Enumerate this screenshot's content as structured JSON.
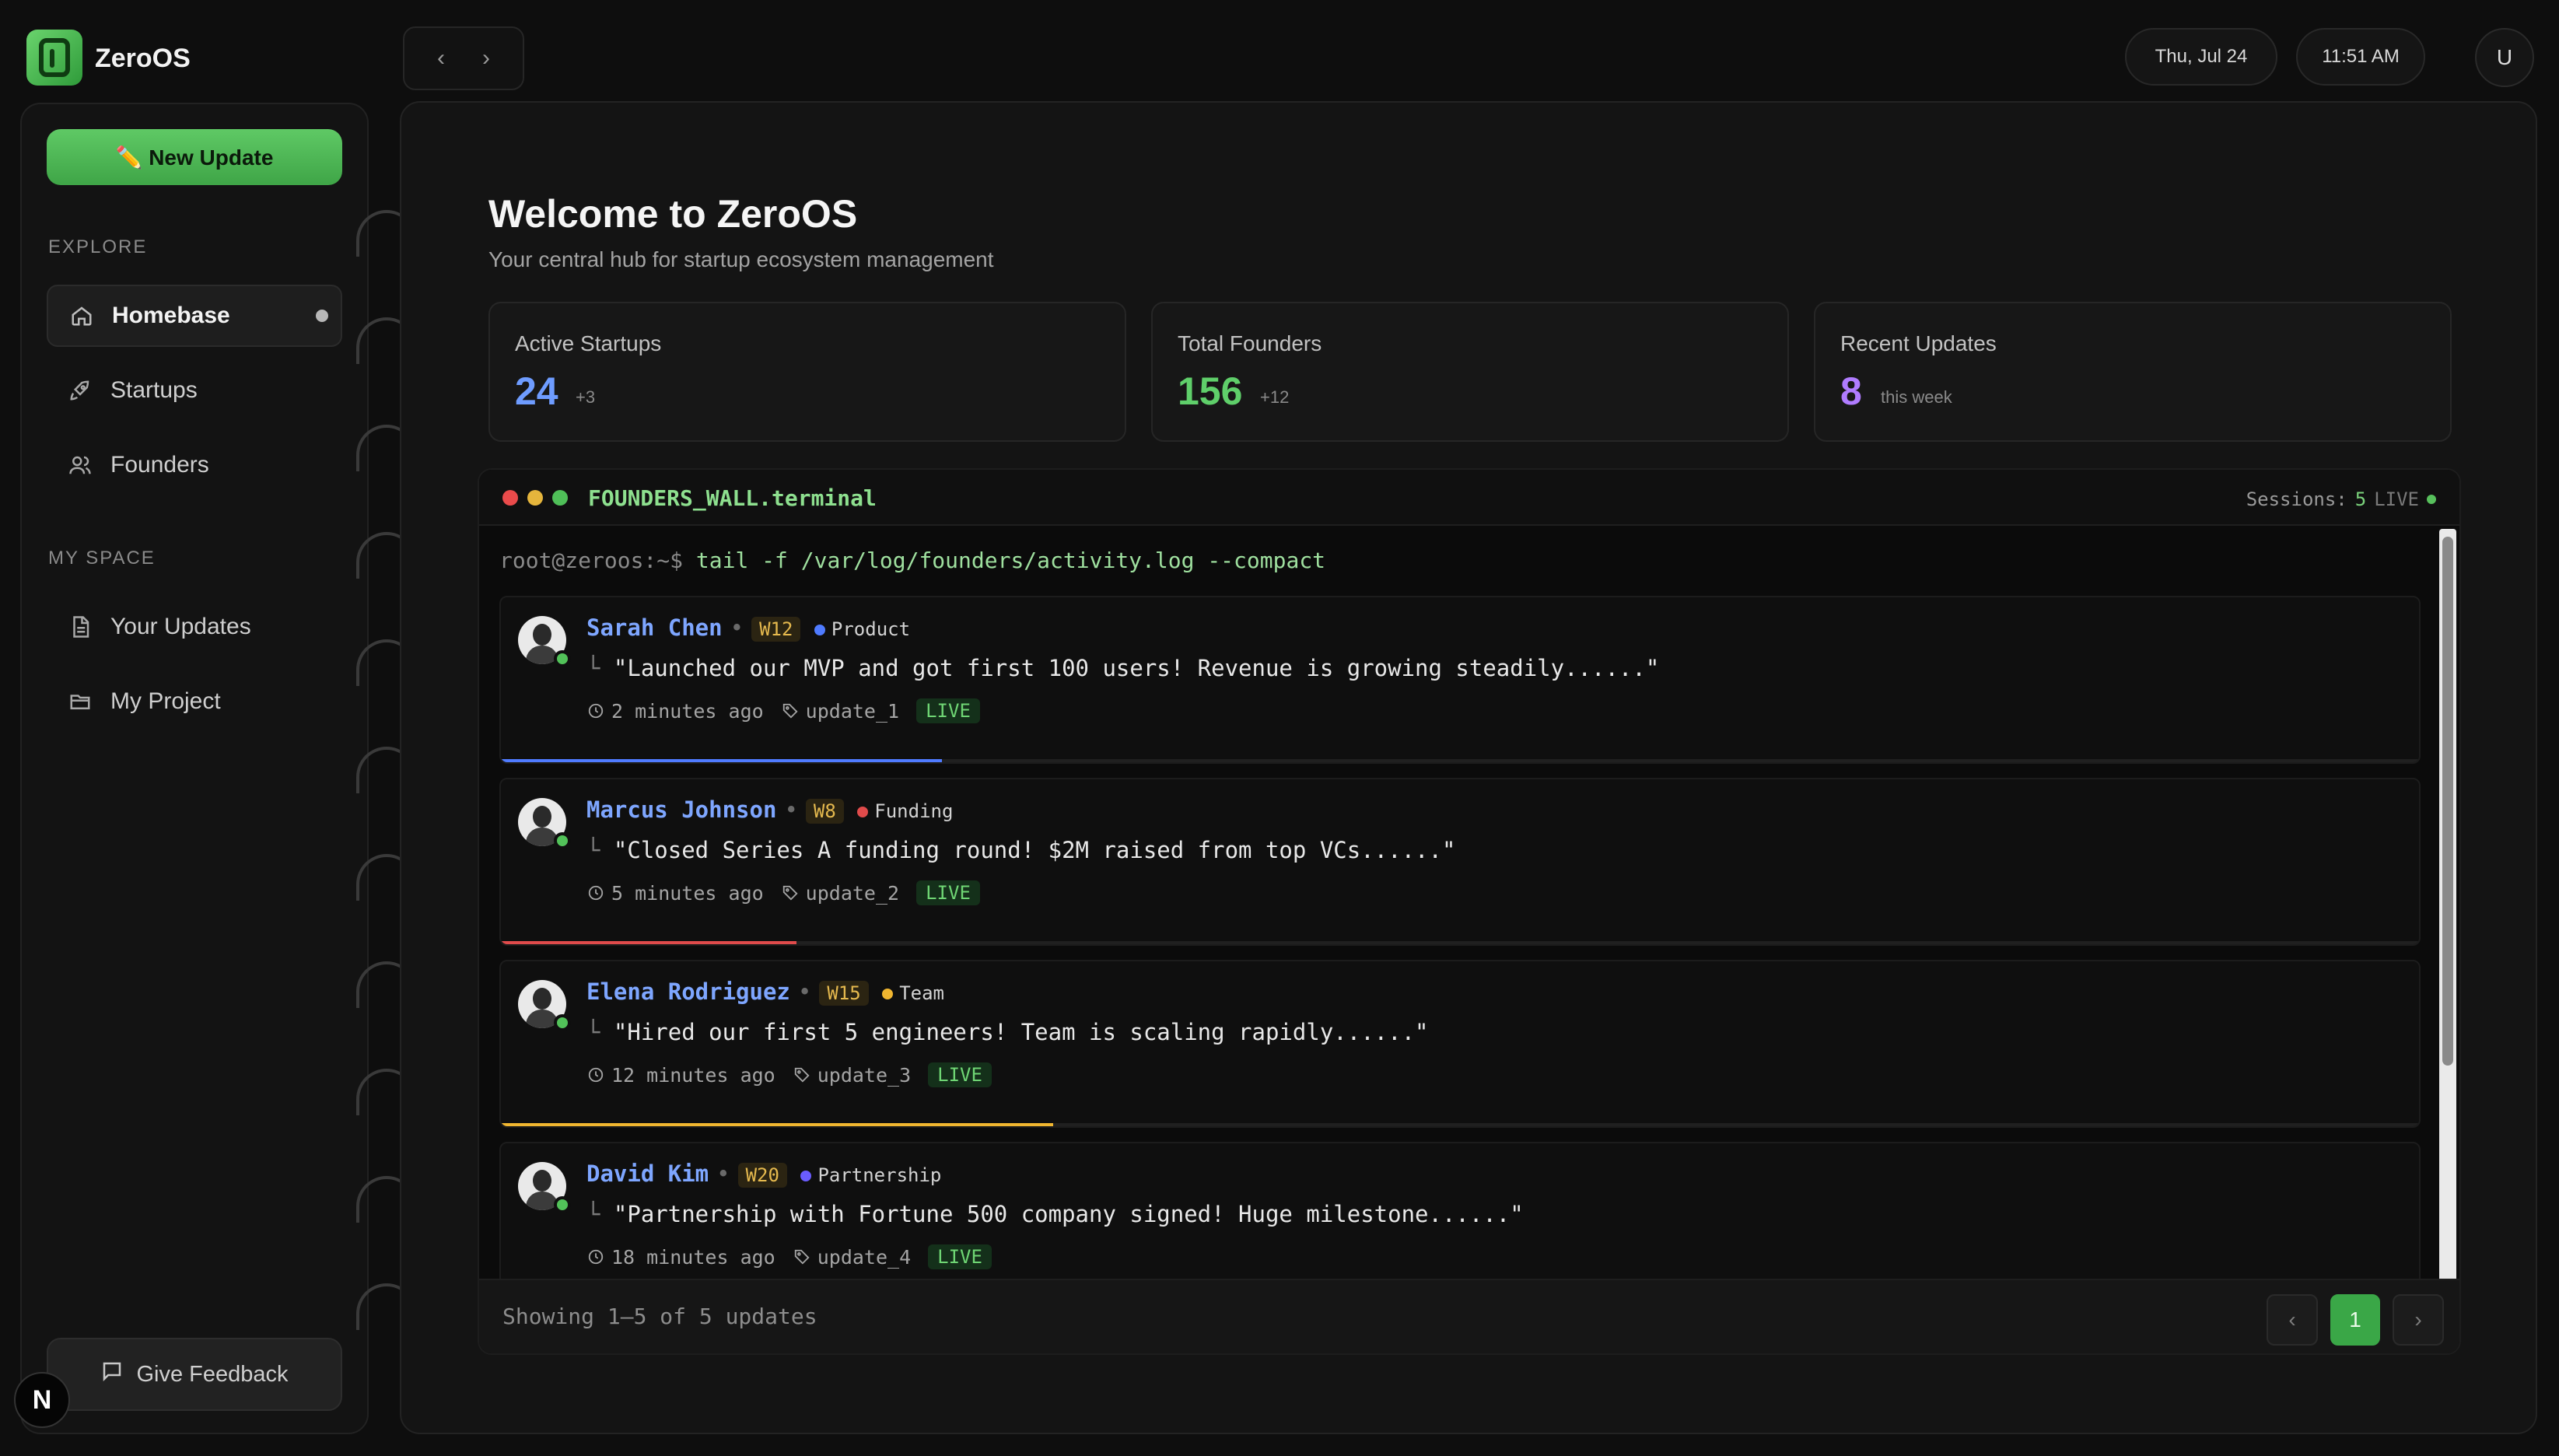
{
  "app": {
    "name": "ZeroOS"
  },
  "header": {
    "date": "Thu, Jul 24",
    "time": "11:51 AM",
    "user_initial": "U"
  },
  "sidebar": {
    "new_update": "✏️ New Update",
    "explore_title": "EXPLORE",
    "explore_items": [
      {
        "label": "Homebase",
        "icon": "home-icon",
        "active": true
      },
      {
        "label": "Startups",
        "icon": "rocket-icon"
      },
      {
        "label": "Founders",
        "icon": "users-icon"
      }
    ],
    "myspace_title": "MY SPACE",
    "myspace_items": [
      {
        "label": "Your Updates",
        "icon": "document-icon"
      },
      {
        "label": "My Project",
        "icon": "folder-icon"
      }
    ],
    "feedback": "Give Feedback",
    "badge": "N"
  },
  "main": {
    "title": "Welcome to ZeroOS",
    "subtitle": "Your central hub for startup ecosystem management",
    "stats": [
      {
        "label": "Active Startups",
        "value": "24",
        "delta": "+3",
        "color": "#6e9cff"
      },
      {
        "label": "Total Founders",
        "value": "156",
        "delta": "+12",
        "color": "#5fcf6a"
      },
      {
        "label": "Recent Updates",
        "value": "8",
        "delta": "this week",
        "color": "#b07cff"
      }
    ]
  },
  "terminal": {
    "title": "FOUNDERS_WALL.terminal",
    "sessions_label": "Sessions:",
    "sessions_count": "5",
    "sessions_live": "LIVE",
    "prompt": "root@zeroos:~$",
    "command": "tail -f /var/log/founders/activity.log --compact",
    "entries": [
      {
        "name": "Sarah Chen",
        "week": "W12",
        "category": "Product",
        "cat_color": "#4f7bff",
        "message": "\"Launched our MVP and got first 100 users! Revenue is growing steadily......\"",
        "time": "2 minutes ago",
        "tag": "update_1",
        "status": "LIVE",
        "progress": 0.23,
        "bar_color": "#4f7bff"
      },
      {
        "name": "Marcus Johnson",
        "week": "W8",
        "category": "Funding",
        "cat_color": "#e04b4b",
        "message": "\"Closed Series A funding round! $2M raised from top VCs......\"",
        "time": "5 minutes ago",
        "tag": "update_2",
        "status": "LIVE",
        "progress": 0.154,
        "bar_color": "#e04b4b"
      },
      {
        "name": "Elena Rodriguez",
        "week": "W15",
        "category": "Team",
        "cat_color": "#f0b630",
        "message": "\"Hired our first 5 engineers! Team is scaling rapidly......\"",
        "time": "12 minutes ago",
        "tag": "update_3",
        "status": "LIVE",
        "progress": 0.288,
        "bar_color": "#f0b630"
      },
      {
        "name": "David Kim",
        "week": "W20",
        "category": "Partnership",
        "cat_color": "#6a5cff",
        "message": "\"Partnership with Fortune 500 company signed! Huge milestone......\"",
        "time": "18 minutes ago",
        "tag": "update_4",
        "status": "LIVE",
        "progress": 0.0,
        "bar_color": "#6a5cff"
      }
    ],
    "footer": "Showing 1–5 of 5 updates",
    "page": "1"
  }
}
